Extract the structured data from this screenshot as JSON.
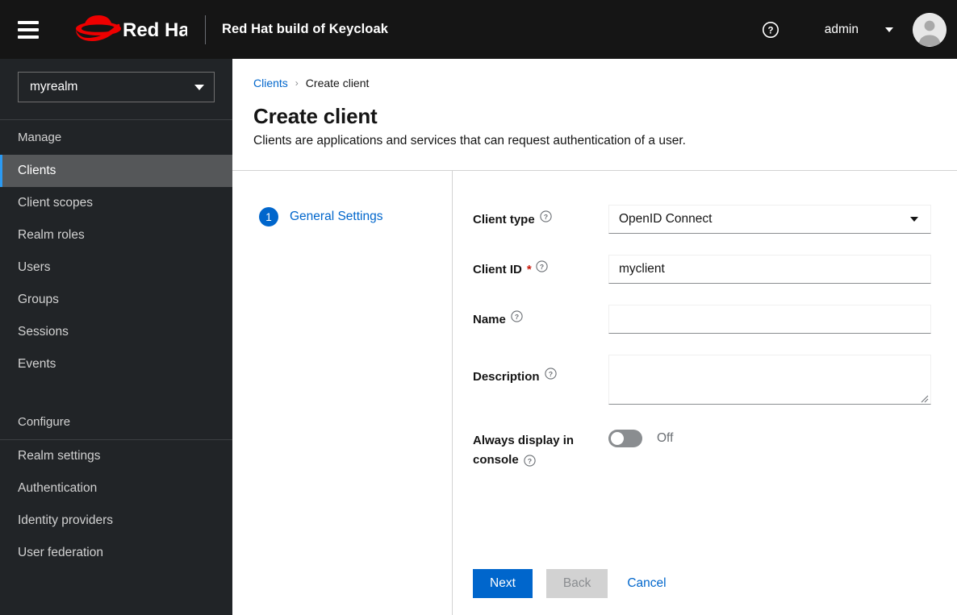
{
  "masthead": {
    "menu_icon": "hamburger-icon",
    "logo_alt": "Red Hat",
    "product_title": "Red Hat build of Keycloak",
    "help_icon": "question-circle-icon",
    "user_name": "admin",
    "user_caret_icon": "caret-down-icon",
    "avatar_icon": "user-avatar-icon"
  },
  "sidebar": {
    "realm_selector": {
      "value": "myrealm",
      "caret_icon": "caret-down-icon"
    },
    "groups": [
      {
        "title": "Manage",
        "items": [
          {
            "label": "Clients",
            "active": true
          },
          {
            "label": "Client scopes",
            "active": false
          },
          {
            "label": "Realm roles",
            "active": false
          },
          {
            "label": "Users",
            "active": false
          },
          {
            "label": "Groups",
            "active": false
          },
          {
            "label": "Sessions",
            "active": false
          },
          {
            "label": "Events",
            "active": false
          }
        ]
      },
      {
        "title": "Configure",
        "items": [
          {
            "label": "Realm settings",
            "active": false
          },
          {
            "label": "Authentication",
            "active": false
          },
          {
            "label": "Identity providers",
            "active": false
          },
          {
            "label": "User federation",
            "active": false
          }
        ]
      }
    ]
  },
  "content": {
    "breadcrumb": {
      "parent": "Clients",
      "separator": "›",
      "current": "Create client"
    },
    "page_title": "Create client",
    "page_subtitle": "Clients are applications and services that can request authentication of a user.",
    "wizard": {
      "steps": [
        {
          "number": "1",
          "label": "General Settings"
        }
      ]
    },
    "form": {
      "client_type": {
        "label": "Client type",
        "help_icon": "question-circle-icon",
        "value": "OpenID Connect",
        "caret_icon": "caret-down-icon"
      },
      "client_id": {
        "label": "Client ID",
        "required_marker": "*",
        "help_icon": "question-circle-icon",
        "value": "myclient",
        "placeholder": ""
      },
      "name": {
        "label": "Name",
        "help_icon": "question-circle-icon",
        "value": "",
        "placeholder": ""
      },
      "description": {
        "label": "Description",
        "help_icon": "question-circle-icon",
        "value": "",
        "placeholder": ""
      },
      "always_display": {
        "label_line1": "Always display in",
        "label_line2": "console",
        "help_icon": "question-circle-icon",
        "state_label": "Off",
        "checked": false
      }
    },
    "actions": {
      "next": "Next",
      "back": "Back",
      "cancel": "Cancel"
    }
  },
  "colors": {
    "brand_red": "#ee0000",
    "masthead_bg": "#151515",
    "sidebar_bg": "#212427",
    "sidebar_active_bg": "#555759",
    "accent_blue": "#0066cc",
    "active_border": "#2b9af3",
    "required_red": "#c9190b",
    "toggle_off": "#8a8d90"
  }
}
